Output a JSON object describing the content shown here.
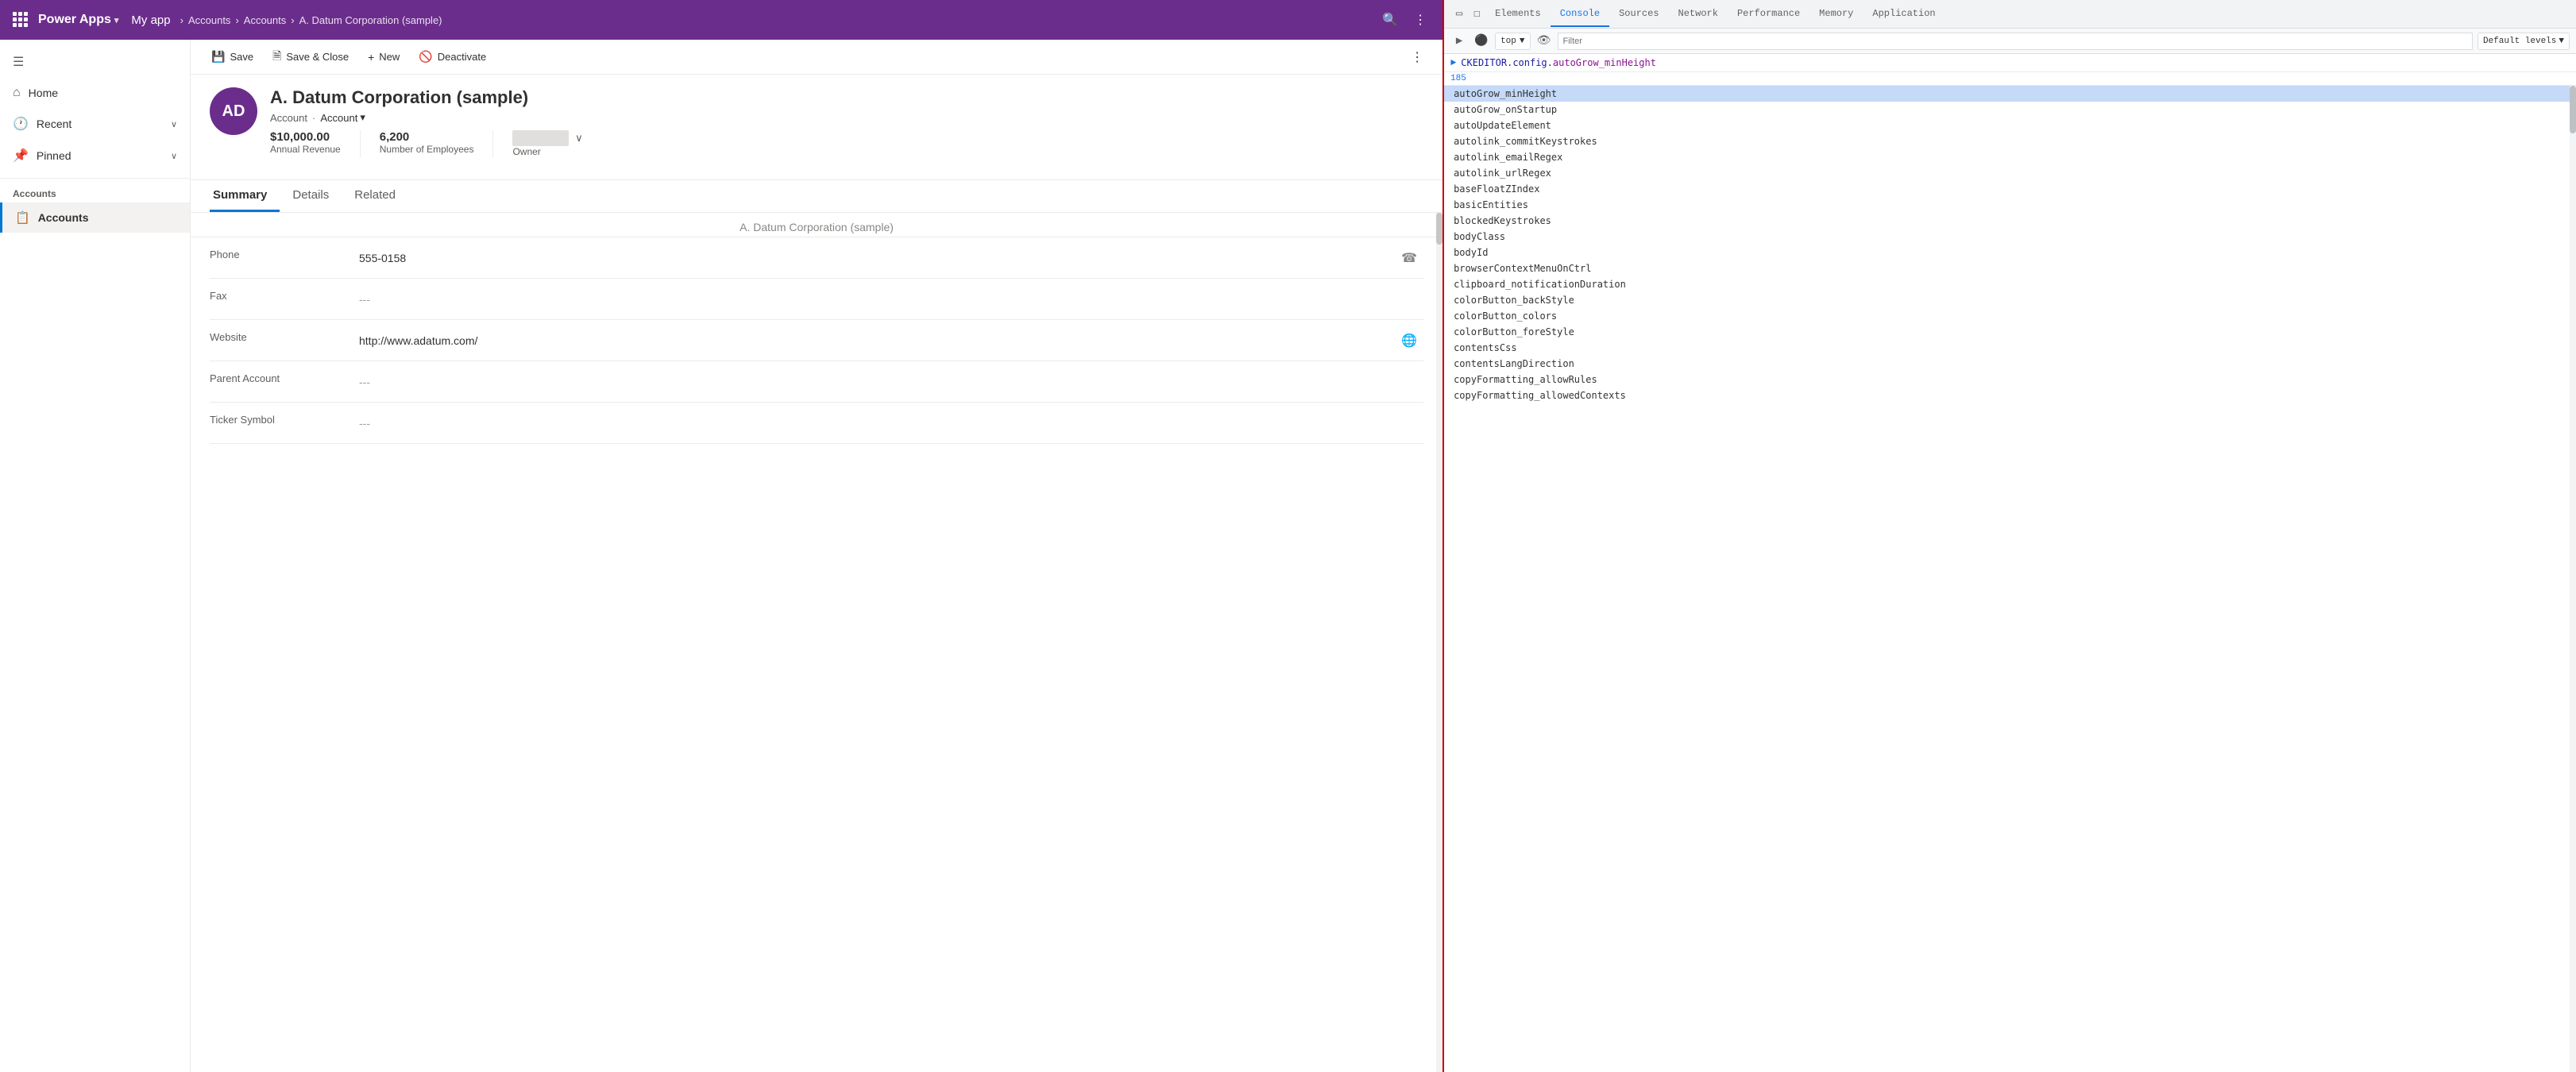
{
  "topNav": {
    "brand": "Power Apps",
    "brandChevron": "▾",
    "appName": "My app",
    "breadcrumbs": [
      "Accounts",
      "Accounts",
      "A. Datum Corporation (sample)"
    ],
    "separator": "›"
  },
  "sidebar": {
    "menuItems": [
      {
        "label": "Home",
        "icon": "⌂"
      },
      {
        "label": "Recent",
        "icon": "🕐",
        "hasChevron": true
      },
      {
        "label": "Pinned",
        "icon": "📌",
        "hasChevron": true
      }
    ],
    "sectionLabel": "Accounts",
    "navItems": [
      {
        "label": "Accounts",
        "icon": "📋",
        "active": true
      }
    ]
  },
  "commandBar": {
    "save": "Save",
    "saveClose": "Save & Close",
    "new": "New",
    "deactivate": "Deactivate"
  },
  "record": {
    "initials": "AD",
    "name": "A. Datum Corporation (sample)",
    "typeLabel": "Account",
    "typePrimary": "Account",
    "typeDropdown": "▾",
    "stats": {
      "revenue": "$10,000.00",
      "revenueLabel": "Annual Revenue",
      "employees": "6,200",
      "employeesLabel": "Number of Employees",
      "ownerLabel": "Owner"
    },
    "tabs": [
      "Summary",
      "Details",
      "Related"
    ],
    "activeTab": "Summary",
    "recordNameValue": "A. Datum Corporation (sample)",
    "fields": [
      {
        "label": "Phone",
        "value": "555-0158",
        "icon": "☎",
        "empty": false
      },
      {
        "label": "Fax",
        "value": "---",
        "icon": "",
        "empty": true
      },
      {
        "label": "Website",
        "value": "http://www.adatum.com/",
        "icon": "🌐",
        "empty": false
      },
      {
        "label": "Parent Account",
        "value": "---",
        "icon": "",
        "empty": true
      },
      {
        "label": "Ticker Symbol",
        "value": "---",
        "icon": "",
        "empty": true
      }
    ]
  },
  "devtools": {
    "tabs": [
      "Elements",
      "Console",
      "Sources",
      "Network",
      "Performance",
      "Memory",
      "Application"
    ],
    "activeTab": "Console",
    "toolbar": {
      "contextSelector": "top",
      "filterPlaceholder": "Filter",
      "levelsLabel": "Default levels"
    },
    "consoleInput": "CKEDITOR.config.autoGrow_minHeight",
    "lineNumber": "185",
    "autocomplete": {
      "selectedItem": "autoGrow_minHeight",
      "items": [
        "autoGrow_minHeight",
        "autoGrow_onStartup",
        "autoUpdateElement",
        "autolink_commitKeystrokes",
        "autolink_emailRegex",
        "autolink_urlRegex",
        "baseFloatZIndex",
        "basicEntities",
        "blockedKeystrokes",
        "bodyClass",
        "bodyId",
        "browserContextMenuOnCtrl",
        "clipboard_notificationDuration",
        "colorButton_backStyle",
        "colorButton_colors",
        "colorButton_foreStyle",
        "contentsCss",
        "contentsLangDirection",
        "copyFormatting_allowRules",
        "copyFormatting_allowedContexts"
      ]
    }
  }
}
